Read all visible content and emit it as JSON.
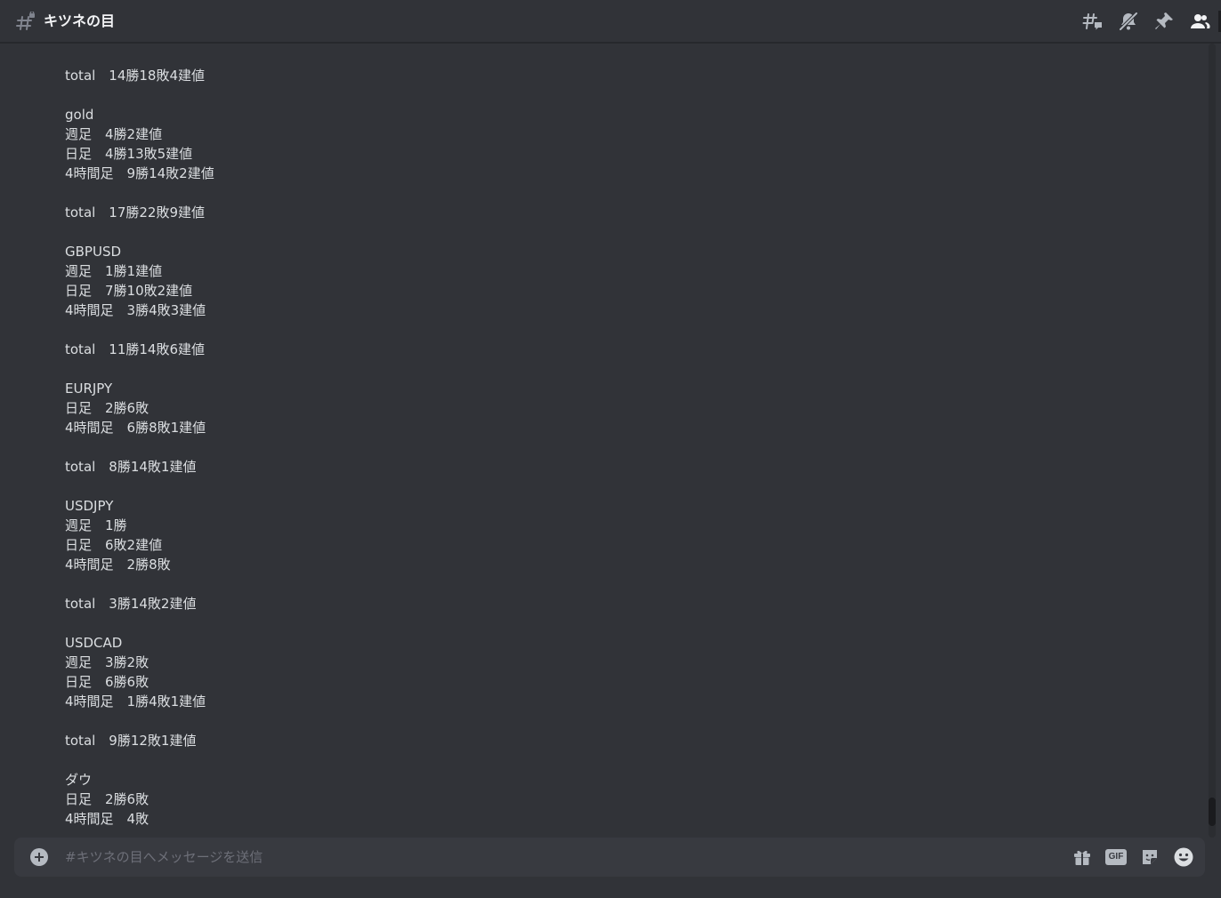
{
  "header": {
    "channel_name": "キツネの目",
    "icons": [
      "threads-icon",
      "notifications-muted-icon",
      "pin-icon",
      "members-icon"
    ]
  },
  "messages": {
    "lines": [
      "total　14勝18敗4建値",
      "",
      "gold",
      "週足　4勝2建値",
      "日足　4勝13敗5建値",
      "4時間足　9勝14敗2建値",
      "",
      "total　17勝22敗9建値",
      "",
      "GBPUSD",
      "週足　1勝1建値",
      "日足　7勝10敗2建値",
      "4時間足　3勝4敗3建値",
      "",
      "total　11勝14敗6建値",
      "",
      "EURJPY",
      "日足　2勝6敗",
      "4時間足　6勝8敗1建値",
      "",
      "total　8勝14敗1建値",
      "",
      "USDJPY",
      "週足　1勝",
      "日足　6敗2建値",
      "4時間足　2勝8敗",
      "",
      "total　3勝14敗2建値",
      "",
      "USDCAD",
      "週足　3勝2敗",
      "日足　6勝6敗",
      "4時間足　1勝4敗1建値",
      "",
      "total　9勝12敗1建値",
      "",
      "ダウ",
      "日足　2勝6敗",
      "4時間足　4敗"
    ]
  },
  "composer": {
    "placeholder": "#キツネの目へメッセージを送信",
    "value": "",
    "gif_label": "GIF",
    "icons": [
      "add-attachment-icon",
      "gift-icon",
      "gif-icon",
      "sticker-icon",
      "emoji-icon"
    ]
  },
  "colors": {
    "background": "#313338",
    "composer_bg": "#383a40",
    "text": "#dbdee1",
    "icon": "#b5bac1",
    "placeholder": "#6d6f78"
  }
}
